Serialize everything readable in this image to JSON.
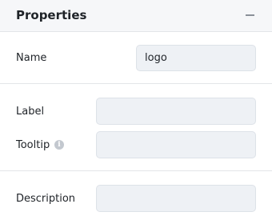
{
  "panel": {
    "title": "Properties"
  },
  "fields": {
    "name": {
      "label": "Name",
      "value": "logo"
    },
    "label": {
      "label": "Label",
      "value": ""
    },
    "tooltip": {
      "label": "Tooltip",
      "value": ""
    },
    "description": {
      "label": "Description",
      "value": ""
    }
  },
  "icons": {
    "collapse": "minus-icon",
    "tooltip_info": "info-icon"
  }
}
